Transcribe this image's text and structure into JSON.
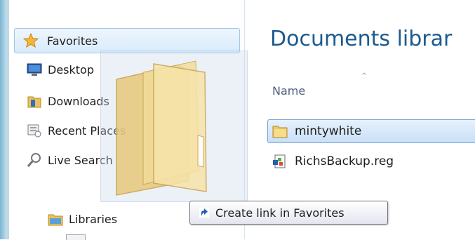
{
  "navigation": {
    "favorites": {
      "label": "Favorites",
      "icon": "star-icon"
    },
    "items": [
      {
        "label": "Desktop",
        "icon": "desktop-icon"
      },
      {
        "label": "Downloads",
        "icon": "downloads-folder-icon"
      },
      {
        "label": "Recent Places",
        "icon": "recent-places-icon"
      },
      {
        "label": "Live Search",
        "icon": "search-icon"
      }
    ],
    "libraries": {
      "label": "Libraries",
      "icon": "libraries-icon"
    }
  },
  "main": {
    "title": "Documents librar",
    "column_header": "Name",
    "files": [
      {
        "name": "mintywhite",
        "type": "folder",
        "selected": true
      },
      {
        "name": "RichsBackup.reg",
        "type": "registry-file",
        "selected": false
      }
    ]
  },
  "drag": {
    "tooltip": "Create link in Favorites",
    "dragged_item_icon": "folder-icon"
  },
  "colors": {
    "title": "#1e5a8d",
    "selection": "#c9e0f8",
    "frame": "#a9d2e6"
  }
}
